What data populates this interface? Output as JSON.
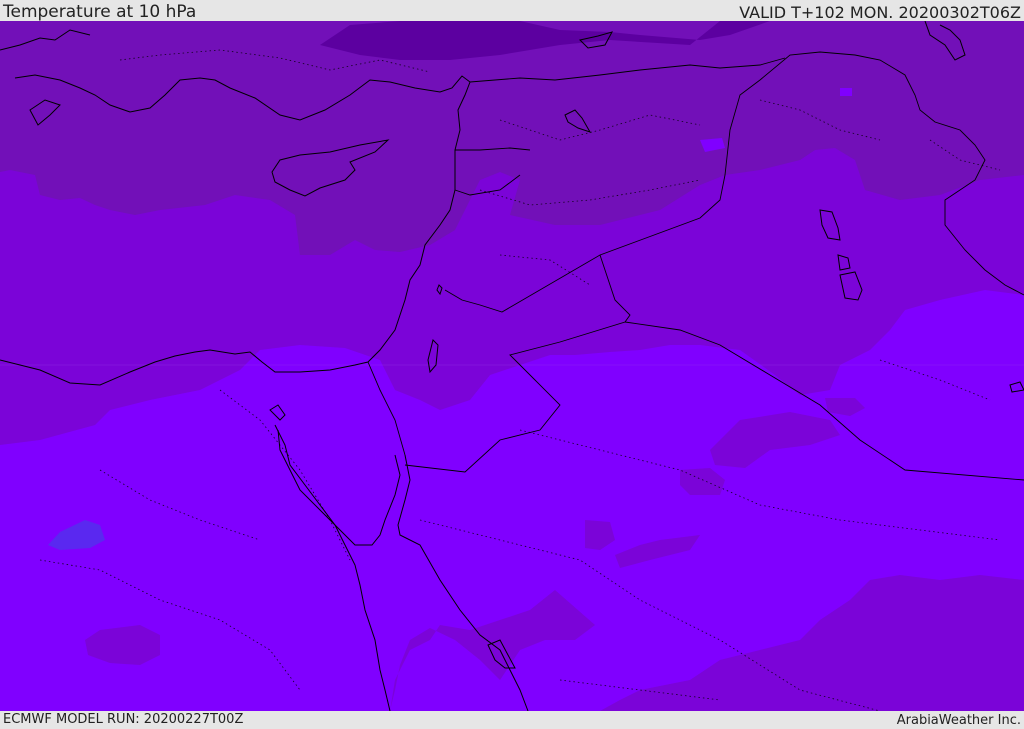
{
  "header": {
    "title": "Temperature at 10 hPa",
    "valid": "VALID T+102 MON. 20200302T06Z"
  },
  "footer": {
    "model_run": "ECMWF MODEL RUN: 20200227T00Z",
    "credit": "ArabiaWeather Inc."
  },
  "colors": {
    "band_darkest": "#5c00a0",
    "band_dark": "#7210b8",
    "band_mid": "#7b04d8",
    "band_light": "#8000ff",
    "band_blue": "#5a28f0",
    "coastline": "#000000",
    "header_bg": "#e6e6e6"
  }
}
